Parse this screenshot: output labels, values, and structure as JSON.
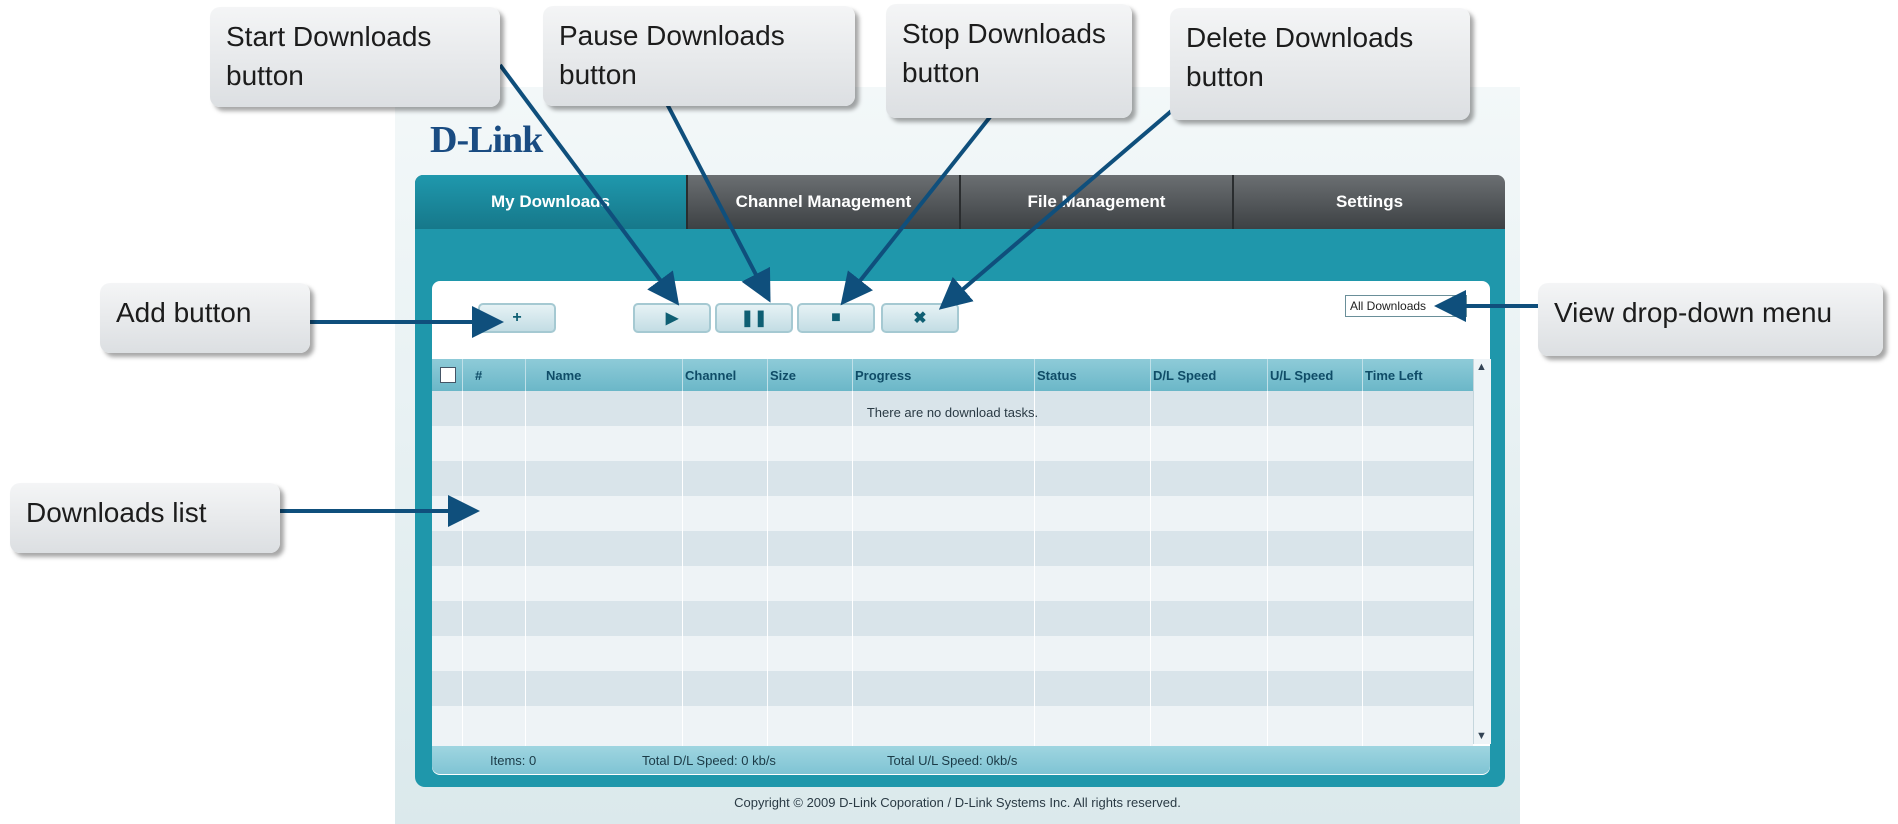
{
  "logo_text": "D-Link",
  "nav": {
    "tabs": [
      "My Downloads",
      "Channel Management",
      "File Management",
      "Settings"
    ]
  },
  "toolbar": {
    "add_icon": "plus-icon",
    "start_icon": "play-icon",
    "pause_icon": "pause-icon",
    "stop_icon": "stop-icon",
    "delete_icon": "x-icon",
    "view_selected": "All Downloads"
  },
  "table": {
    "columns": [
      "#",
      "Name",
      "Channel",
      "Size",
      "Progress",
      "Status",
      "D/L Speed",
      "U/L Speed",
      "Time Left"
    ],
    "empty_message": "There are no download tasks."
  },
  "status_bar": {
    "items": "Items: 0",
    "total_dl": "Total D/L Speed: 0 kb/s",
    "total_ul": "Total U/L Speed: 0kb/s"
  },
  "footer": "Copyright © 2009 D-Link Coporation / D-Link Systems Inc. All rights reserved.",
  "callouts": {
    "start": "Start Downloads button",
    "pause": "Pause Downloads button",
    "stop": "Stop Downloads button",
    "delete": "Delete Downloads button",
    "add": "Add button",
    "view": "View drop-down menu",
    "list": "Downloads list"
  },
  "colors": {
    "accent": "#1f97ab",
    "brand": "#1a4c82",
    "arrow": "#0f4f7c"
  }
}
